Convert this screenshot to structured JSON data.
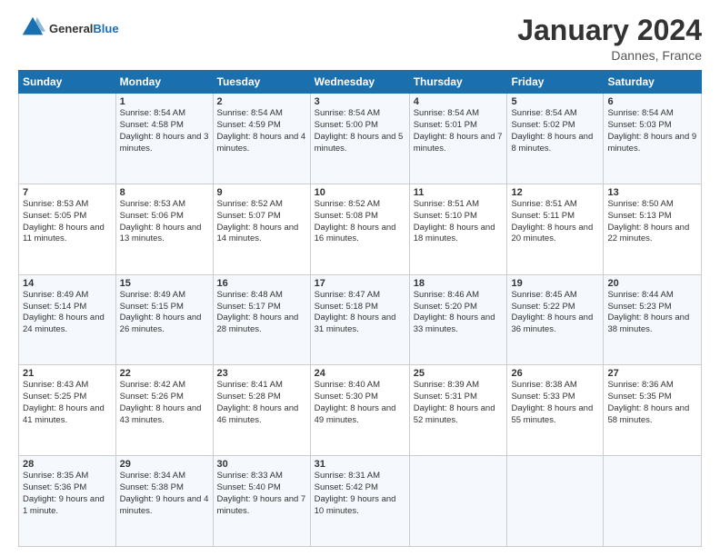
{
  "logo": {
    "text_general": "General",
    "text_blue": "Blue"
  },
  "header": {
    "month_year": "January 2024",
    "location": "Dannes, France"
  },
  "days_of_week": [
    "Sunday",
    "Monday",
    "Tuesday",
    "Wednesday",
    "Thursday",
    "Friday",
    "Saturday"
  ],
  "weeks": [
    [
      {
        "day": "",
        "sunrise": "",
        "sunset": "",
        "daylight": ""
      },
      {
        "day": "1",
        "sunrise": "Sunrise: 8:54 AM",
        "sunset": "Sunset: 4:58 PM",
        "daylight": "Daylight: 8 hours and 3 minutes."
      },
      {
        "day": "2",
        "sunrise": "Sunrise: 8:54 AM",
        "sunset": "Sunset: 4:59 PM",
        "daylight": "Daylight: 8 hours and 4 minutes."
      },
      {
        "day": "3",
        "sunrise": "Sunrise: 8:54 AM",
        "sunset": "Sunset: 5:00 PM",
        "daylight": "Daylight: 8 hours and 5 minutes."
      },
      {
        "day": "4",
        "sunrise": "Sunrise: 8:54 AM",
        "sunset": "Sunset: 5:01 PM",
        "daylight": "Daylight: 8 hours and 7 minutes."
      },
      {
        "day": "5",
        "sunrise": "Sunrise: 8:54 AM",
        "sunset": "Sunset: 5:02 PM",
        "daylight": "Daylight: 8 hours and 8 minutes."
      },
      {
        "day": "6",
        "sunrise": "Sunrise: 8:54 AM",
        "sunset": "Sunset: 5:03 PM",
        "daylight": "Daylight: 8 hours and 9 minutes."
      }
    ],
    [
      {
        "day": "7",
        "sunrise": "Sunrise: 8:53 AM",
        "sunset": "Sunset: 5:05 PM",
        "daylight": "Daylight: 8 hours and 11 minutes."
      },
      {
        "day": "8",
        "sunrise": "Sunrise: 8:53 AM",
        "sunset": "Sunset: 5:06 PM",
        "daylight": "Daylight: 8 hours and 13 minutes."
      },
      {
        "day": "9",
        "sunrise": "Sunrise: 8:52 AM",
        "sunset": "Sunset: 5:07 PM",
        "daylight": "Daylight: 8 hours and 14 minutes."
      },
      {
        "day": "10",
        "sunrise": "Sunrise: 8:52 AM",
        "sunset": "Sunset: 5:08 PM",
        "daylight": "Daylight: 8 hours and 16 minutes."
      },
      {
        "day": "11",
        "sunrise": "Sunrise: 8:51 AM",
        "sunset": "Sunset: 5:10 PM",
        "daylight": "Daylight: 8 hours and 18 minutes."
      },
      {
        "day": "12",
        "sunrise": "Sunrise: 8:51 AM",
        "sunset": "Sunset: 5:11 PM",
        "daylight": "Daylight: 8 hours and 20 minutes."
      },
      {
        "day": "13",
        "sunrise": "Sunrise: 8:50 AM",
        "sunset": "Sunset: 5:13 PM",
        "daylight": "Daylight: 8 hours and 22 minutes."
      }
    ],
    [
      {
        "day": "14",
        "sunrise": "Sunrise: 8:49 AM",
        "sunset": "Sunset: 5:14 PM",
        "daylight": "Daylight: 8 hours and 24 minutes."
      },
      {
        "day": "15",
        "sunrise": "Sunrise: 8:49 AM",
        "sunset": "Sunset: 5:15 PM",
        "daylight": "Daylight: 8 hours and 26 minutes."
      },
      {
        "day": "16",
        "sunrise": "Sunrise: 8:48 AM",
        "sunset": "Sunset: 5:17 PM",
        "daylight": "Daylight: 8 hours and 28 minutes."
      },
      {
        "day": "17",
        "sunrise": "Sunrise: 8:47 AM",
        "sunset": "Sunset: 5:18 PM",
        "daylight": "Daylight: 8 hours and 31 minutes."
      },
      {
        "day": "18",
        "sunrise": "Sunrise: 8:46 AM",
        "sunset": "Sunset: 5:20 PM",
        "daylight": "Daylight: 8 hours and 33 minutes."
      },
      {
        "day": "19",
        "sunrise": "Sunrise: 8:45 AM",
        "sunset": "Sunset: 5:22 PM",
        "daylight": "Daylight: 8 hours and 36 minutes."
      },
      {
        "day": "20",
        "sunrise": "Sunrise: 8:44 AM",
        "sunset": "Sunset: 5:23 PM",
        "daylight": "Daylight: 8 hours and 38 minutes."
      }
    ],
    [
      {
        "day": "21",
        "sunrise": "Sunrise: 8:43 AM",
        "sunset": "Sunset: 5:25 PM",
        "daylight": "Daylight: 8 hours and 41 minutes."
      },
      {
        "day": "22",
        "sunrise": "Sunrise: 8:42 AM",
        "sunset": "Sunset: 5:26 PM",
        "daylight": "Daylight: 8 hours and 43 minutes."
      },
      {
        "day": "23",
        "sunrise": "Sunrise: 8:41 AM",
        "sunset": "Sunset: 5:28 PM",
        "daylight": "Daylight: 8 hours and 46 minutes."
      },
      {
        "day": "24",
        "sunrise": "Sunrise: 8:40 AM",
        "sunset": "Sunset: 5:30 PM",
        "daylight": "Daylight: 8 hours and 49 minutes."
      },
      {
        "day": "25",
        "sunrise": "Sunrise: 8:39 AM",
        "sunset": "Sunset: 5:31 PM",
        "daylight": "Daylight: 8 hours and 52 minutes."
      },
      {
        "day": "26",
        "sunrise": "Sunrise: 8:38 AM",
        "sunset": "Sunset: 5:33 PM",
        "daylight": "Daylight: 8 hours and 55 minutes."
      },
      {
        "day": "27",
        "sunrise": "Sunrise: 8:36 AM",
        "sunset": "Sunset: 5:35 PM",
        "daylight": "Daylight: 8 hours and 58 minutes."
      }
    ],
    [
      {
        "day": "28",
        "sunrise": "Sunrise: 8:35 AM",
        "sunset": "Sunset: 5:36 PM",
        "daylight": "Daylight: 9 hours and 1 minute."
      },
      {
        "day": "29",
        "sunrise": "Sunrise: 8:34 AM",
        "sunset": "Sunset: 5:38 PM",
        "daylight": "Daylight: 9 hours and 4 minutes."
      },
      {
        "day": "30",
        "sunrise": "Sunrise: 8:33 AM",
        "sunset": "Sunset: 5:40 PM",
        "daylight": "Daylight: 9 hours and 7 minutes."
      },
      {
        "day": "31",
        "sunrise": "Sunrise: 8:31 AM",
        "sunset": "Sunset: 5:42 PM",
        "daylight": "Daylight: 9 hours and 10 minutes."
      },
      {
        "day": "",
        "sunrise": "",
        "sunset": "",
        "daylight": ""
      },
      {
        "day": "",
        "sunrise": "",
        "sunset": "",
        "daylight": ""
      },
      {
        "day": "",
        "sunrise": "",
        "sunset": "",
        "daylight": ""
      }
    ]
  ]
}
